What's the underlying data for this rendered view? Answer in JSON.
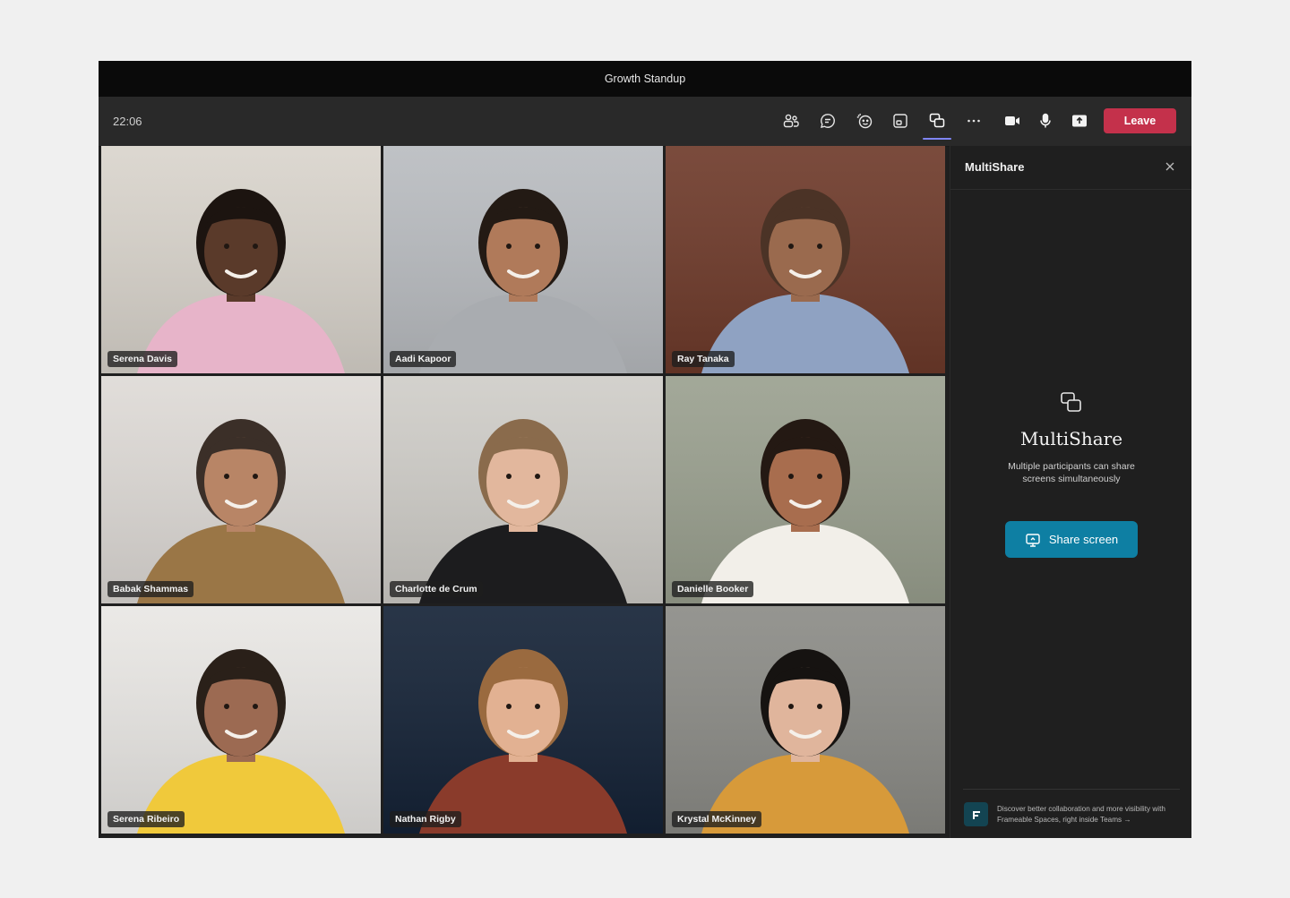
{
  "window": {
    "title": "Growth Standup"
  },
  "toolbar": {
    "time": "22:06",
    "buttons": [
      {
        "name": "people-icon",
        "label": "People"
      },
      {
        "name": "chat-icon",
        "label": "Chat"
      },
      {
        "name": "react-icon",
        "label": "React"
      },
      {
        "name": "view-icon",
        "label": "View"
      },
      {
        "name": "multishare-icon",
        "label": "MultiShare",
        "active": true
      },
      {
        "name": "more-options-icon",
        "label": "More"
      },
      {
        "name": "camera-icon",
        "label": "Camera"
      },
      {
        "name": "mic-icon",
        "label": "Mic"
      },
      {
        "name": "share-tray-icon",
        "label": "Share"
      }
    ],
    "leave_label": "Leave",
    "leave_color": "#c4314b",
    "active_indicator_color": "#7f85f5"
  },
  "participants": [
    {
      "name": "Serena Davis",
      "bg": "#d9d4cc",
      "skin": "#5a3a2a",
      "hair": "#1c1410",
      "shirt": "#e7b4c9"
    },
    {
      "name": "Aadi Kapoor",
      "bg": "#b9bcc0",
      "skin": "#b07a5a",
      "hair": "#231a14",
      "shirt": "#a9acb0"
    },
    {
      "name": "Ray Tanaka",
      "bg": "#6e3a2a",
      "skin": "#9a6a4e",
      "hair": "#4b3326",
      "shirt": "#8fa2c2"
    },
    {
      "name": "Babak Shammas",
      "bg": "#dedad6",
      "skin": "#b88566",
      "hair": "#3b2f28",
      "shirt": "#9a7646"
    },
    {
      "name": "Charlotte de Crum",
      "bg": "#cfcdc8",
      "skin": "#e2b79d",
      "hair": "#8a6b4c",
      "shirt": "#1c1c1e"
    },
    {
      "name": "Danielle Booker",
      "bg": "#9aa08f",
      "skin": "#a86d4e",
      "hair": "#241913",
      "shirt": "#f2efe9"
    },
    {
      "name": "Serena Ribeiro",
      "bg": "#e9e7e4",
      "skin": "#9c6a52",
      "hair": "#2a2019",
      "shirt": "#f0c93b"
    },
    {
      "name": "Nathan Rigby",
      "bg": "#142236",
      "skin": "#e2b192",
      "hair": "#9a6a3f",
      "shirt": "#8a3b2b"
    },
    {
      "name": "Krystal McKinney",
      "bg": "#8b8b86",
      "skin": "#e0b59c",
      "hair": "#161311",
      "shirt": "#d79a3a"
    }
  ],
  "panel": {
    "title": "MultiShare",
    "heading": "MultiShare",
    "description": "Multiple participants can share screens simultaneously",
    "share_button_label": "Share screen",
    "share_button_color": "#0e7fa3",
    "footer_text": "Discover better collaboration and more visibility with Frameable Spaces, right inside Teams →"
  }
}
